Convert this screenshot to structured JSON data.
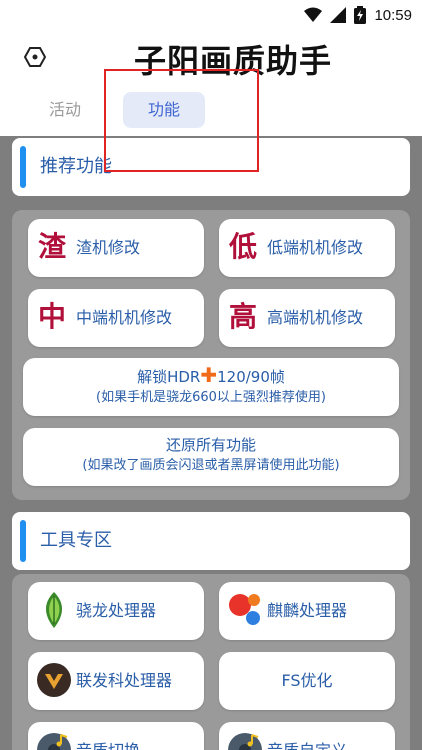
{
  "status_bar": {
    "time": "10:59"
  },
  "header": {
    "title": "子阳画质助手",
    "tabs": [
      {
        "label": "活动",
        "active": false
      },
      {
        "label": "功能",
        "active": true
      }
    ]
  },
  "sections": {
    "recommended": {
      "title": "推荐功能"
    },
    "tools": {
      "title": "工具专区"
    }
  },
  "recommended_buttons": [
    {
      "char": "渣",
      "label": "渣机修改"
    },
    {
      "char": "低",
      "label": "低端机机修改"
    },
    {
      "char": "中",
      "label": "中端机机修改"
    },
    {
      "char": "高",
      "label": "高端机机修改"
    }
  ],
  "unlock_button": {
    "prefix": "解锁HDR",
    "plus": "✚",
    "suffix": "120/90帧",
    "note": "(如果手机是骁龙660以上强烈推荐使用)"
  },
  "restore_button": {
    "title": "还原所有功能",
    "note": "(如果改了画质会闪退或者黑屏请使用此功能)"
  },
  "tools": [
    {
      "icon": "snapdragon-icon",
      "label": "骁龙处理器"
    },
    {
      "icon": "kirin-icon",
      "label": "麒麟处理器"
    },
    {
      "icon": "mediatek-icon",
      "label": "联发科处理器"
    },
    {
      "icon": "",
      "label": "FS优化"
    },
    {
      "icon": "music-icon",
      "label": "音质切换"
    },
    {
      "icon": "music-icon",
      "label": "音质自定义"
    }
  ],
  "colors": {
    "accent_blue": "#1f8ff0",
    "text_blue": "#2a5ea8",
    "char_red": "#b0103a",
    "plus_orange": "#f06a1a",
    "annotation_red": "#e02424"
  }
}
